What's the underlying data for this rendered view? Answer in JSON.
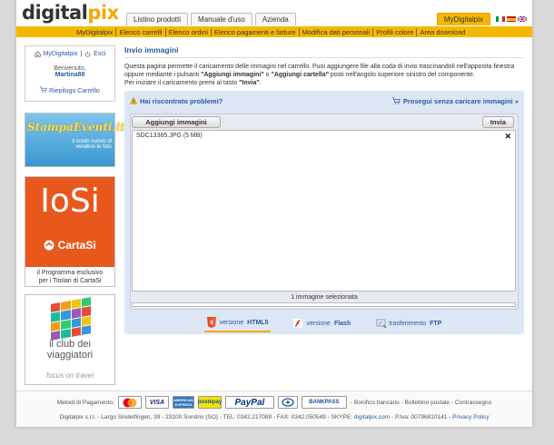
{
  "header": {
    "logo_part1": "digital",
    "logo_part2": "pix",
    "tabs": [
      {
        "label": "Listino prodotti"
      },
      {
        "label": "Manuale d'uso"
      },
      {
        "label": "Azienda"
      }
    ],
    "account_tab": "MyDigitalpix"
  },
  "subnav": {
    "items": [
      {
        "label": "MyDigitalpix"
      },
      {
        "label": "Elenco carrelli"
      },
      {
        "label": "Elenco ordini"
      },
      {
        "label": "Elenco pagamenti e fatture"
      },
      {
        "label": "Modifica dati personali"
      },
      {
        "label": "Profili colore"
      },
      {
        "label": "Area download"
      }
    ]
  },
  "sidebar": {
    "my_link": "MyDigitalpix",
    "sep": "|",
    "logout": "Esci",
    "welcome": "Benvenuto,",
    "username": "Martina88",
    "cart_summary": "Riepilogo Carrello",
    "banner1_title": "StampaEventi.it",
    "banner1_tagline_1": "il modo nuovo di",
    "banner1_tagline_2": "vendere le foto",
    "banner2_title": "IoSi",
    "banner2_brand": "CartaSi",
    "banner2_caption_1": "il Programma esclusivo",
    "banner2_caption_2": "per i Titolari di CartaSi",
    "banner3_title_1": "il club dei",
    "banner3_title_2": "viaggiatori",
    "banner3_tagline": "focus on travel"
  },
  "main": {
    "title": "Invio immagini",
    "intro_1": "Questa pagina permette il caricamento delle immagini nel carrello. Puoi aggiungere file alla coda di invio trascinandoli nell'apposita finestra oppure mediante i pulsanti ",
    "intro_b1": "\"Aggiungi immagini\"",
    "intro_2": " o ",
    "intro_b2": "\"Aggiungi cartella\"",
    "intro_3": " posti nell'angolo superiore sinistro del componente.",
    "intro_4": "Per iniziare il caricamento premi al tasto ",
    "intro_b3": "\"Invia\"",
    "intro_5": "."
  },
  "uploader": {
    "problems_link": "Hai riscontrato problemi?",
    "skip_link": "Prosegui senza caricare immagini »",
    "add_button": "Aggiungi immagini",
    "send_button": "Invia",
    "files": [
      {
        "name": "SDC13365.JPG (5 MB)"
      }
    ],
    "remove_glyph": "✕",
    "count_text": "1 immagine selezionata",
    "progress": 0,
    "modes": [
      {
        "prefix": "versione",
        "name": "HTML5",
        "active": true
      },
      {
        "prefix": "versione",
        "name": "Flash",
        "active": false
      },
      {
        "prefix": "trasferimento",
        "name": "FTP",
        "active": false
      }
    ]
  },
  "footer": {
    "payment_label": "Metodi di Pagamento:",
    "methods": [
      {
        "label": "MasterCard"
      },
      {
        "label": "VISA"
      },
      {
        "label": "AMERICAN EXPRESS"
      },
      {
        "label": "postepay"
      },
      {
        "label": "PayPal"
      },
      {
        "label": "MyBank"
      },
      {
        "label": "BANKPASS"
      }
    ],
    "other_methods": "- Bonifico bancario - Bollettino postale - Contrassegno",
    "legal_text": "Digitalpix s.r.l. - Largo Sindelfingen, 39 - 23100 Sondrio (SO) - TEL: 0342.217089 - FAX: 0342.050549 - SKYPE: ",
    "skype": "digitalpix.com",
    "vat": " - P.Iva: 00796810141 - ",
    "privacy": "Privacy Policy"
  },
  "colors": {
    "accent": "#f5b800",
    "link": "#2a5aa0",
    "panel": "#dde6f5"
  }
}
